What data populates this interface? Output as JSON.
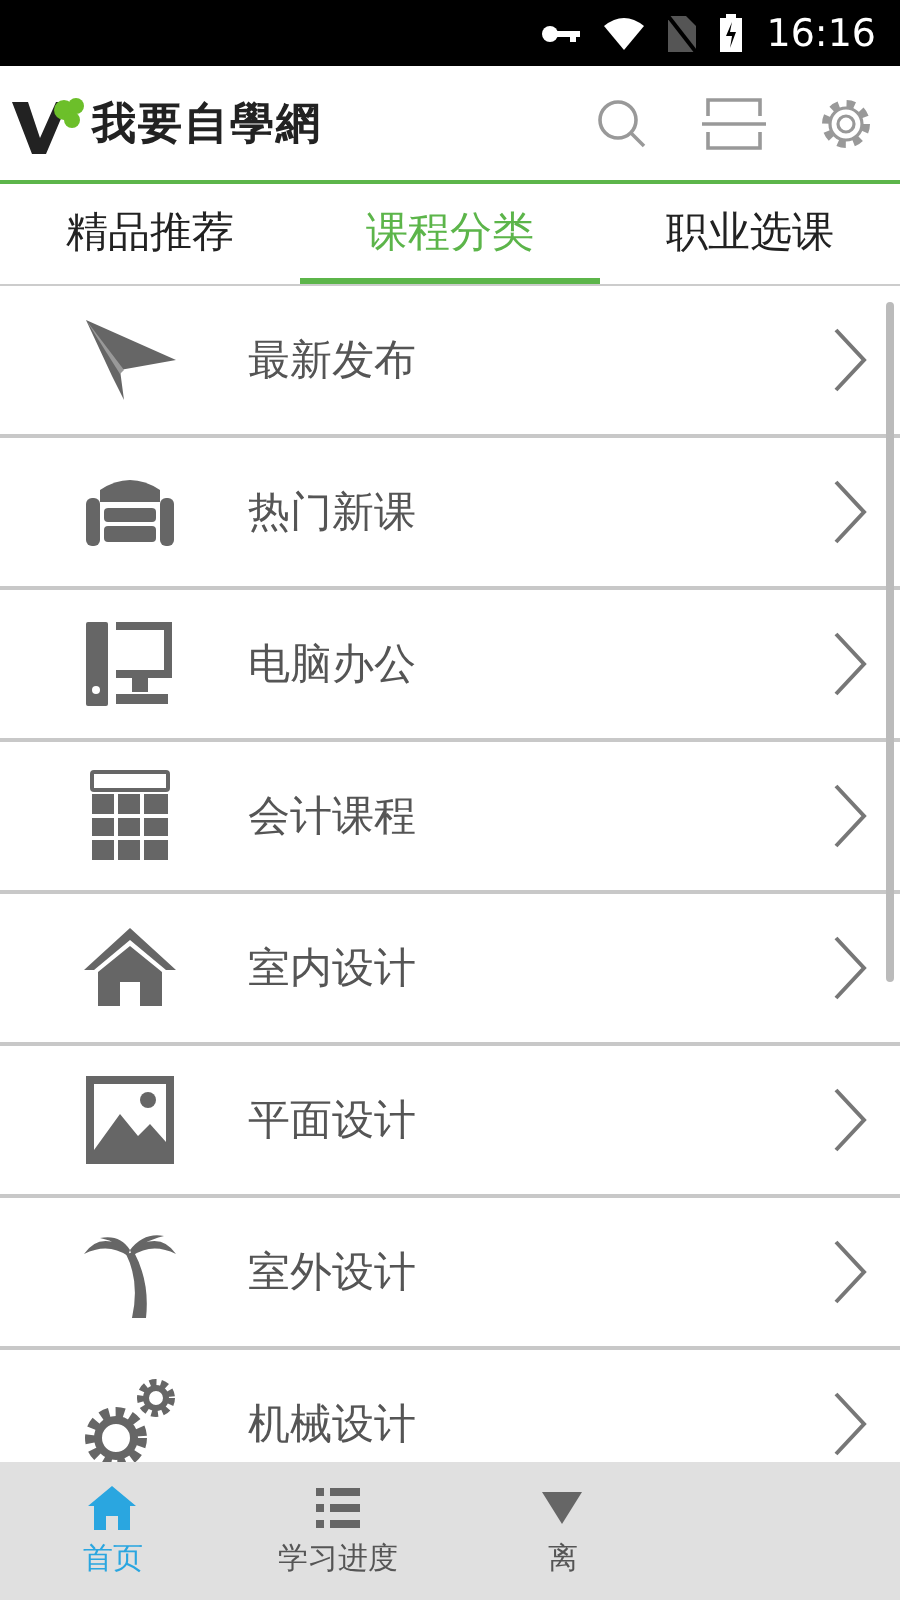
{
  "status_bar": {
    "time": "16:16"
  },
  "header": {
    "logo_text": "我要自學網"
  },
  "tabs": [
    {
      "label": "精品推荐",
      "selected": false
    },
    {
      "label": "课程分类",
      "selected": true
    },
    {
      "label": "职业选课",
      "selected": false
    }
  ],
  "categories": [
    {
      "label": "最新发布",
      "kind": "plane"
    },
    {
      "label": "热门新课",
      "kind": "sofa"
    },
    {
      "label": "电脑办公",
      "kind": "computer"
    },
    {
      "label": "会计课程",
      "kind": "calculator"
    },
    {
      "label": "室内设计",
      "kind": "house"
    },
    {
      "label": "平面设计",
      "kind": "image"
    },
    {
      "label": "室外设计",
      "kind": "palm"
    },
    {
      "label": "机械设计",
      "kind": "gears"
    }
  ],
  "bottom_nav": [
    {
      "label": "首页",
      "kind": "home",
      "selected": true
    },
    {
      "label": "学习进度",
      "kind": "list",
      "selected": false
    },
    {
      "label": "离",
      "kind": "download",
      "selected": false
    }
  ]
}
